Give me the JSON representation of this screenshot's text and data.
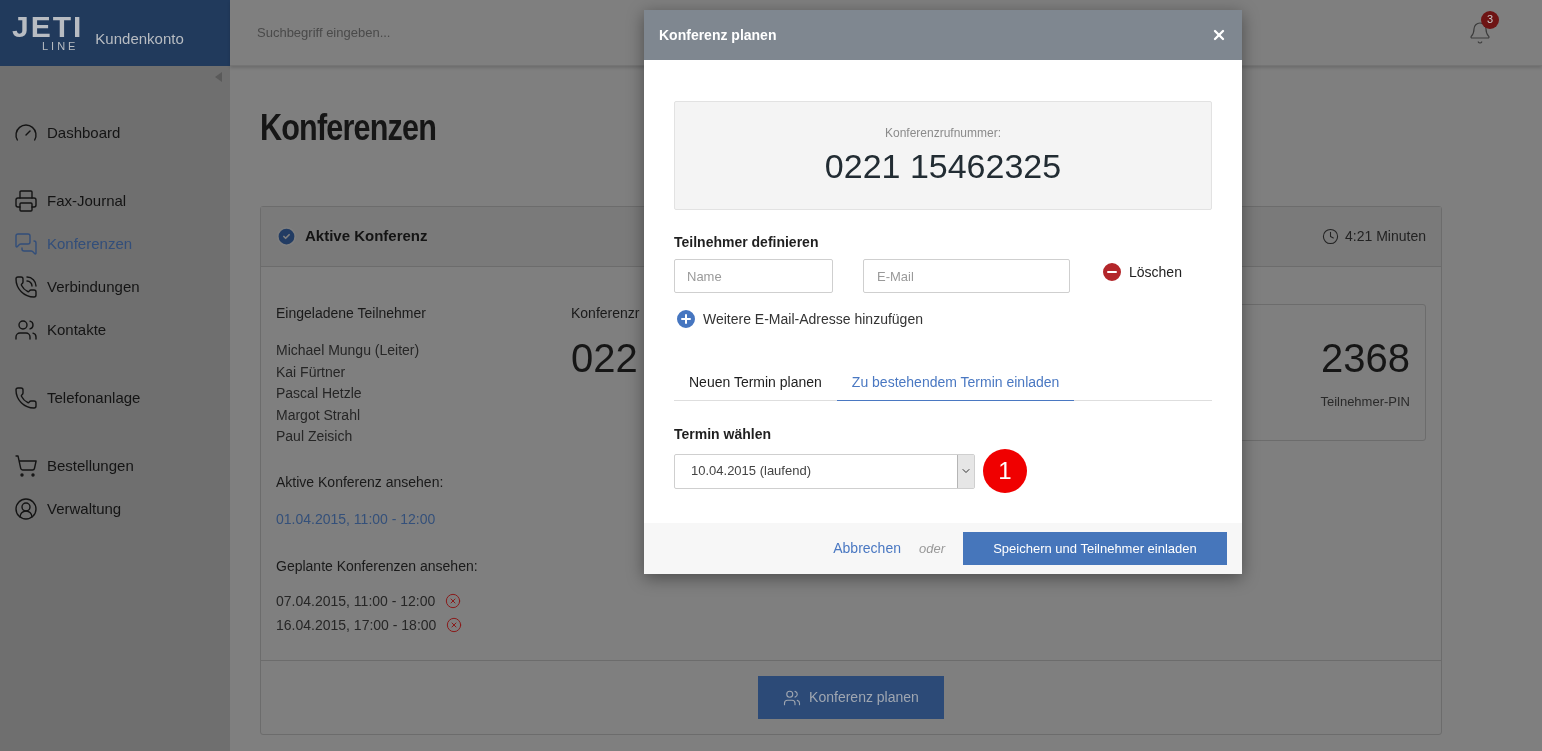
{
  "logo": {
    "top": "JETI",
    "bottom": "LINE",
    "subtitle": "Kundenkonto"
  },
  "search": {
    "placeholder": "Suchbegriff eingeben..."
  },
  "notifications": {
    "count": "3"
  },
  "sidebar": {
    "groups": [
      {
        "items": [
          {
            "label": "Dashboard",
            "selected": false
          }
        ]
      },
      {
        "items": [
          {
            "label": "Fax-Journal",
            "selected": false
          },
          {
            "label": "Konferenzen",
            "selected": true
          },
          {
            "label": "Verbindungen",
            "selected": false
          },
          {
            "label": "Kontakte",
            "selected": false
          }
        ]
      },
      {
        "items": [
          {
            "label": "Telefonanlage",
            "selected": false
          }
        ]
      },
      {
        "items": [
          {
            "label": "Bestellungen",
            "selected": false
          },
          {
            "label": "Verwaltung",
            "selected": false
          }
        ]
      }
    ]
  },
  "page": {
    "title": "Konferenzen"
  },
  "card": {
    "title": "Aktive Konferenz",
    "duration": "4:21 Minuten",
    "participants_heading": "Eingeladene Teilnehmer",
    "participants": [
      "Michael Mungu (Leiter)",
      "Kai Fürtner",
      "Pascal Hetzle",
      "Margot Strahl",
      "Paul Zeisich"
    ],
    "active_heading": "Aktive Konferenz ansehen:",
    "active_link": "01.04.2015, 11:00 - 12:00",
    "planned_heading": "Geplante Konferenzen ansehen:",
    "planned": [
      "07.04.2015, 11:00 - 12:00",
      "16.04.2015, 17:00 - 18:00"
    ],
    "number_label": "Konferenzr",
    "number": "022",
    "pin": "2368",
    "pin_label": "Teilnehmer-PIN",
    "button": "Konferenz planen"
  },
  "modal": {
    "title": "Konferenz planen",
    "number_label": "Konferenzrufnummer:",
    "number": "0221 15462325",
    "participants_heading": "Teilnehmer definieren",
    "name_field": {
      "placeholder": "Name"
    },
    "email_field": {
      "placeholder": "E-Mail"
    },
    "delete": "Löschen",
    "add": "Weitere E-Mail-Adresse hinzufügen",
    "tabs": [
      {
        "label": "Neuen Termin planen",
        "selected": false
      },
      {
        "label": "Zu bestehendem Termin einladen",
        "selected": true
      }
    ],
    "select_label": "Termin wählen",
    "select_value": "10.04.2015 (laufend)",
    "marker": "1",
    "cancel": "Abbrechen",
    "or": "oder",
    "submit": "Speichern und Teilnehmer einladen"
  }
}
